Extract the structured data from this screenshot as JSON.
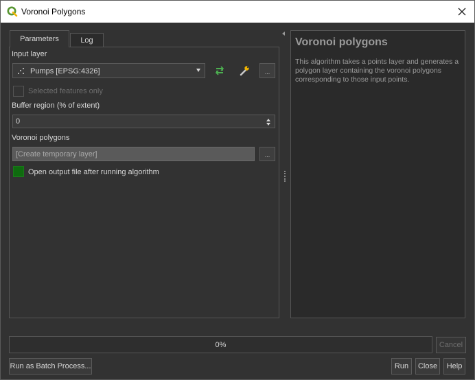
{
  "window": {
    "title": "Voronoi Polygons"
  },
  "tabs": [
    {
      "label": "Parameters"
    },
    {
      "label": "Log"
    }
  ],
  "params": {
    "input_layer_label": "Input layer",
    "input_layer_value": "Pumps [EPSG:4326]",
    "input_more": "...",
    "selected_only_label": "Selected features only",
    "buffer_label": "Buffer region (% of extent)",
    "buffer_value": "0",
    "output_label": "Voronoi polygons",
    "output_placeholder": "[Create temporary layer]",
    "output_more": "...",
    "open_output_label": "Open output file after running algorithm"
  },
  "help": {
    "title": "Voronoi polygons",
    "body": "This algorithm takes a points layer and generates a polygon layer containing the voronoi polygons corresponding to those input points."
  },
  "progress": {
    "value": 0,
    "text": "0%"
  },
  "buttons": {
    "cancel": "Cancel",
    "batch": "Run as Batch Process...",
    "run": "Run",
    "close": "Close",
    "help": "Help"
  },
  "colors": {
    "accent_green": "#0f6b0f",
    "qgis_green": "#589632",
    "panel_bg": "#323232"
  }
}
